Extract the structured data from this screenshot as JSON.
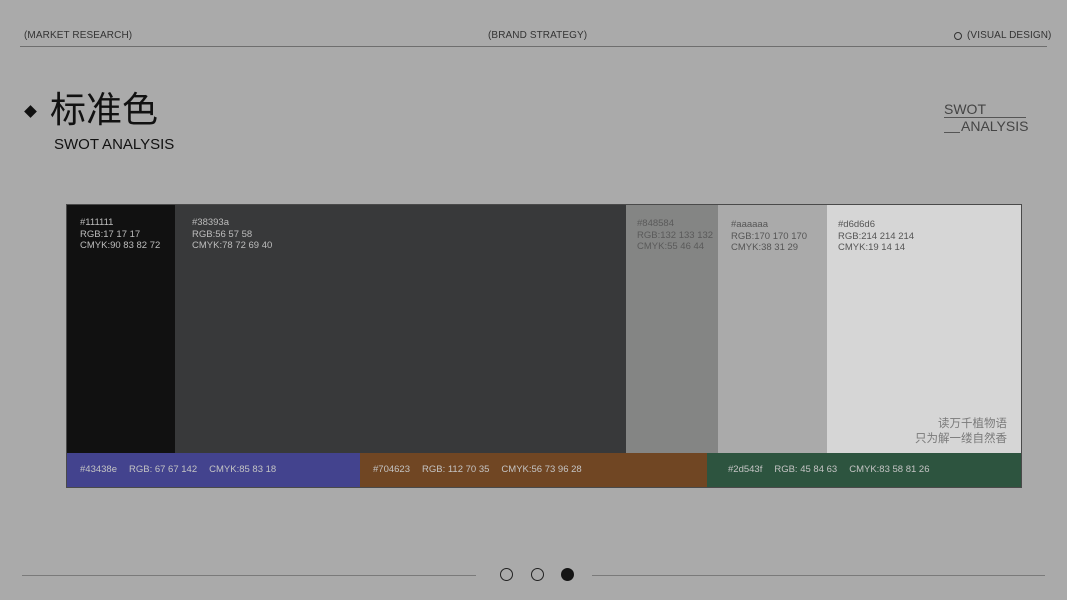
{
  "header": {
    "left_label": "(MARKET RESEARCH)",
    "center_label": "(BRAND STRATEGY)",
    "right_label": "(VISUAL DESIGN)",
    "right_icon": "circle-outline-icon"
  },
  "title": {
    "icon": "diamond-icon",
    "main": "标准色",
    "subtitle": "SWOT ANALYSIS"
  },
  "corner_mark": {
    "line1": "SWOT",
    "line2": "ANALYSIS"
  },
  "palette": {
    "primary": [
      {
        "hex": "#111111",
        "rgb": "RGB:17 17 17",
        "cmyk": "CMYK:90 83 82 72"
      },
      {
        "hex": "#38393a",
        "rgb": "RGB:56 57 58",
        "cmyk": "CMYK:78 72 69 40"
      },
      {
        "hex": "#848584",
        "rgb": "RGB:132 133 132",
        "cmyk": "CMYK:55 46 44"
      },
      {
        "hex": "#aaaaaa",
        "rgb": "RGB:170 170 170",
        "cmyk": "CMYK:38 31 29"
      },
      {
        "hex": "#d6d6d6",
        "rgb": "RGB:214 214 214",
        "cmyk": "CMYK:19 14 14"
      }
    ],
    "accent": [
      {
        "hex": "#43438e",
        "rgb": "RGB: 67 67 142",
        "cmyk": "CMYK:85 83 18"
      },
      {
        "hex": "#704623",
        "rgb": "RGB: 112 70 35",
        "cmyk": "CMYK:56 73 96 28"
      },
      {
        "hex": "#2d543f",
        "rgb": "RGB: 45 84 63",
        "cmyk": "CMYK:83 58 81 26"
      }
    ],
    "slogan": [
      "读万千植物语",
      "只为解一缕自然香"
    ]
  },
  "pagination": {
    "total": 3,
    "current": 3
  },
  "colors": {
    "background": "#aaaaaa",
    "text": "#111111"
  }
}
